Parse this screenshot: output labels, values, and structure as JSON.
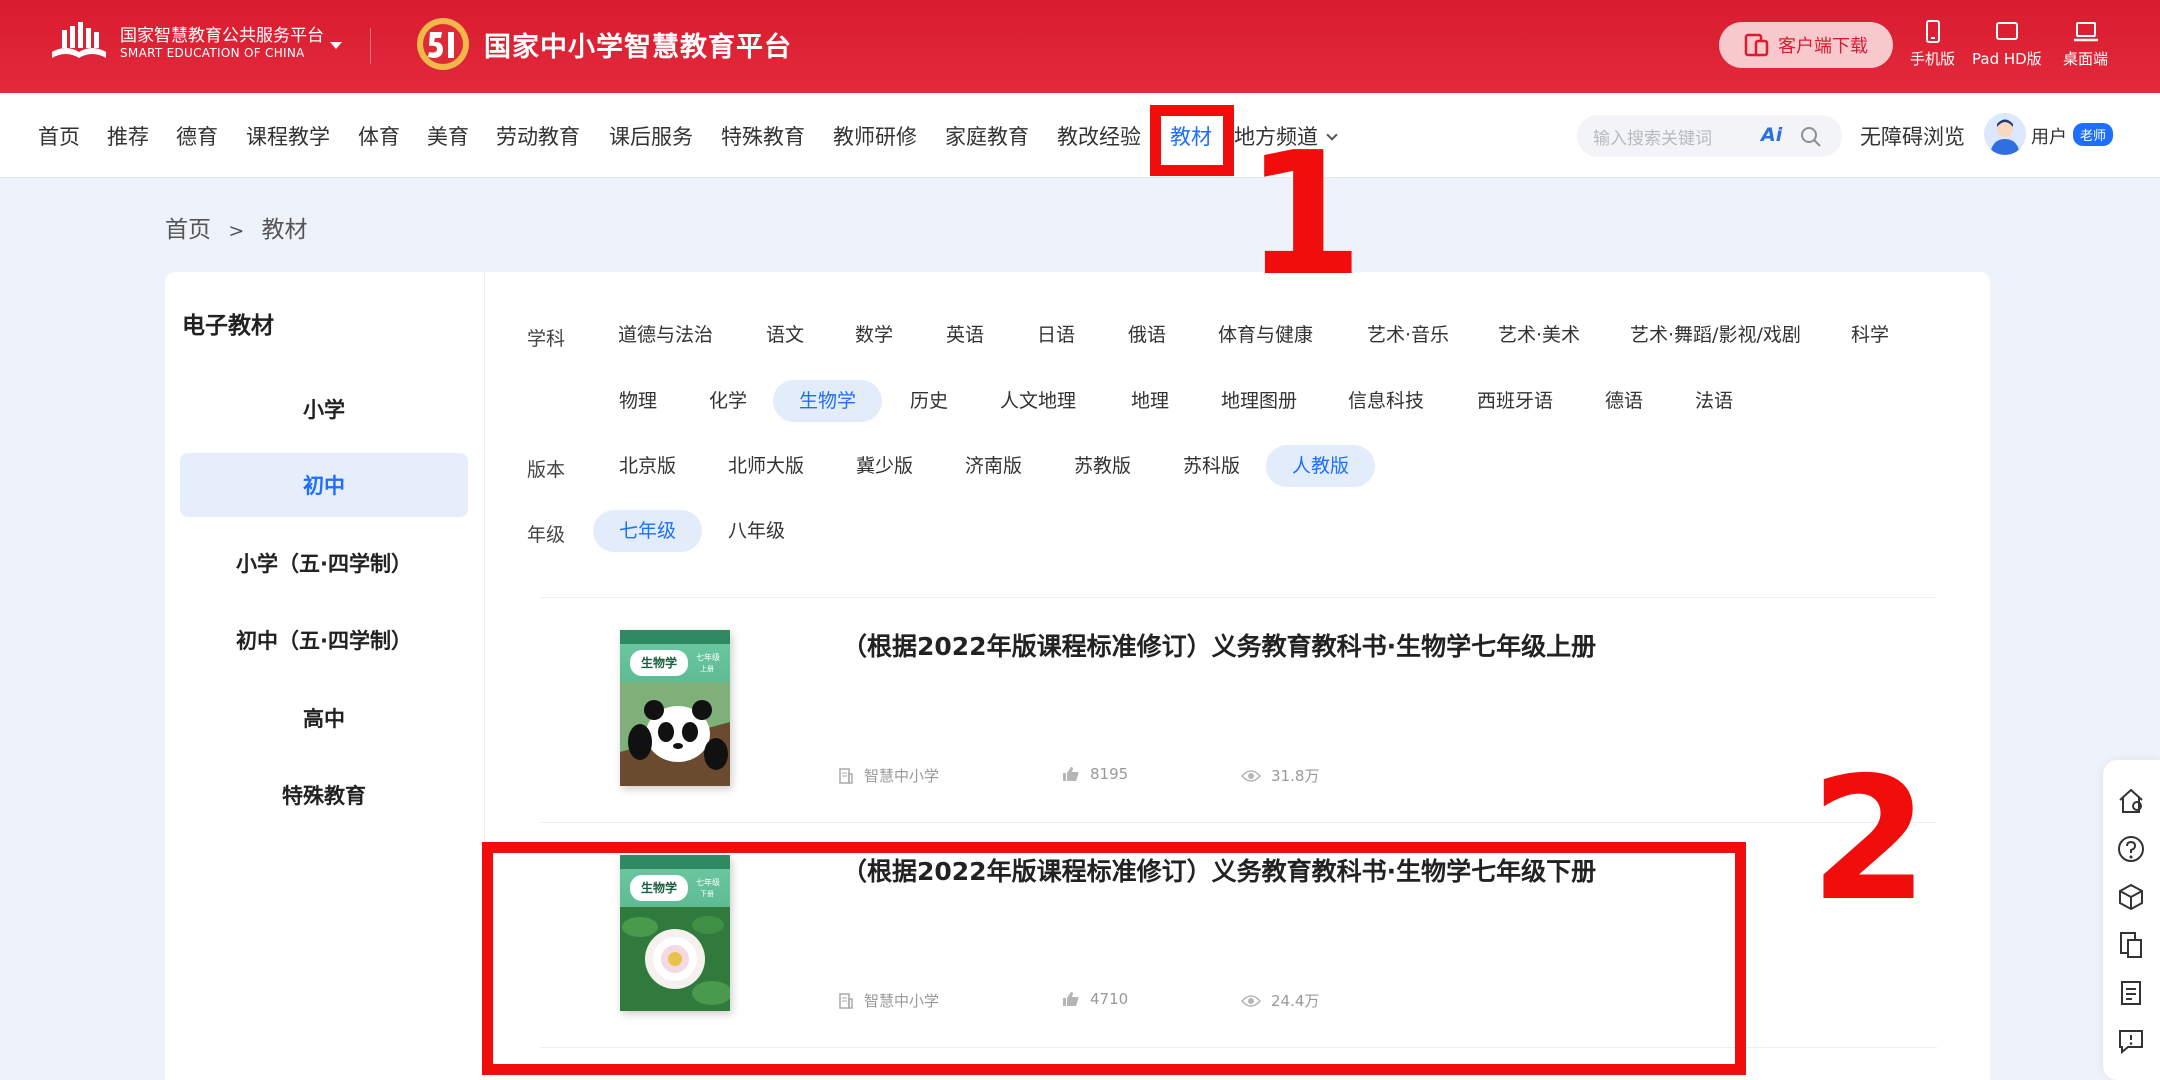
{
  "header": {
    "platform_name_cn": "国家智慧教育公共服务平台",
    "platform_name_en": "SMART EDUCATION OF CHINA",
    "site_title": "国家中小学智慧教育平台",
    "download_label": "客户端下载",
    "devices": [
      "手机版",
      "Pad HD版",
      "桌面端"
    ]
  },
  "nav": {
    "items": [
      "首页",
      "推荐",
      "德育",
      "课程教学",
      "体育",
      "美育",
      "劳动教育",
      "课后服务",
      "特殊教育",
      "教师研修",
      "家庭教育",
      "教改经验",
      "教材",
      "地方频道"
    ],
    "active": "教材",
    "search_placeholder": "输入搜索关键词",
    "search_ai": "Ai",
    "accessibility": "无障碍浏览",
    "user": "用户",
    "role": "老师"
  },
  "breadcrumb": {
    "home": "首页",
    "sep": ">",
    "current": "教材"
  },
  "sidebar": {
    "title": "电子教材",
    "items": [
      "小学",
      "初中",
      "小学（五·四学制）",
      "初中（五·四学制）",
      "高中",
      "特殊教育"
    ],
    "active": "初中"
  },
  "filters": {
    "subject_label": "学科",
    "subjects_row1": [
      "道德与法治",
      "语文",
      "数学",
      "英语",
      "日语",
      "俄语",
      "体育与健康",
      "艺术·音乐",
      "艺术·美术",
      "艺术·舞蹈/影视/戏剧",
      "科学"
    ],
    "subjects_row2": [
      "物理",
      "化学",
      "生物学",
      "历史",
      "人文地理",
      "地理",
      "地理图册",
      "信息科技",
      "西班牙语",
      "德语",
      "法语"
    ],
    "active_subject": "生物学",
    "edition_label": "版本",
    "editions": [
      "北京版",
      "北师大版",
      "冀少版",
      "济南版",
      "苏教版",
      "苏科版",
      "人教版"
    ],
    "active_edition": "人教版",
    "grade_label": "年级",
    "grades": [
      "七年级",
      "八年级"
    ],
    "active_grade": "七年级"
  },
  "books": [
    {
      "title": "（根据2022年版课程标准修订）义务教育教科书·生物学七年级上册",
      "publisher": "智慧中小学",
      "likes": "8195",
      "views": "31.8万",
      "cover_subject": "生物学",
      "cover_grade": "七年级",
      "cover_term": "上册"
    },
    {
      "title": "（根据2022年版课程标准修订）义务教育教科书·生物学七年级下册",
      "publisher": "智慧中小学",
      "likes": "4710",
      "views": "24.4万",
      "cover_subject": "生物学",
      "cover_grade": "七年级",
      "cover_term": "下册"
    }
  ],
  "annotations": {
    "n1": "1",
    "n2": "2",
    "color": "#f20d0d"
  },
  "right_tools": [
    "home-icon",
    "help-icon",
    "cube-icon",
    "copy-icon",
    "document-icon",
    "feedback-icon"
  ],
  "colors": {
    "brand_red": "#d91b2f",
    "accent_blue": "#1e6fff",
    "chip_bg": "#e3ecfb"
  }
}
